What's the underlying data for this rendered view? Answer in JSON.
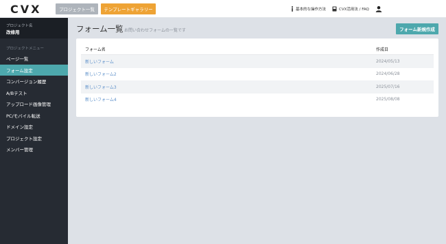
{
  "header": {
    "logo": "CVX",
    "project_list_label": "プロジェクト一覧",
    "template_gallery_label": "テンプレートギャラリー",
    "basic_ops_label": "基本的な操作方法",
    "faq_label": "CVX活用法 / FAQ",
    "icons": [
      "info-icon",
      "book-icon",
      "user-icon"
    ]
  },
  "sidebar": {
    "project_label": "プロジェクト名",
    "project_name": "改修用",
    "menu_heading": "プロジェクトメニュー",
    "items": [
      {
        "label": "ページ一覧",
        "active": false
      },
      {
        "label": "フォーム設定",
        "active": true
      },
      {
        "label": "コンバージョン履歴",
        "active": false
      },
      {
        "label": "A/Bテスト",
        "active": false
      },
      {
        "label": "アップロード画像管理",
        "active": false
      },
      {
        "label": "PC/モバイル転送",
        "active": false
      },
      {
        "label": "ドメイン設定",
        "active": false
      },
      {
        "label": "プロジェクト設定",
        "active": false
      },
      {
        "label": "メンバー管理",
        "active": false
      }
    ]
  },
  "main": {
    "title": "フォーム一覧",
    "subtitle": "お問い合わせフォームの一覧です",
    "new_button_label": "フォーム新規作成",
    "table": {
      "columns": [
        "フォーム名",
        "作成日"
      ],
      "rows": [
        {
          "name": "新しいフォーム",
          "date": "2024/05/13"
        },
        {
          "name": "新しいフォーム2",
          "date": "2024/06/28"
        },
        {
          "name": "新しいフォーム3",
          "date": "2025/07/16"
        },
        {
          "name": "新しいフォーム4",
          "date": "2025/08/08"
        }
      ]
    }
  },
  "colors": {
    "accent": "#4da8ad",
    "template_button": "#eea335",
    "sidebar_bg": "#262b33",
    "page_bg": "#dde1e7",
    "link": "#5b8fc9"
  }
}
